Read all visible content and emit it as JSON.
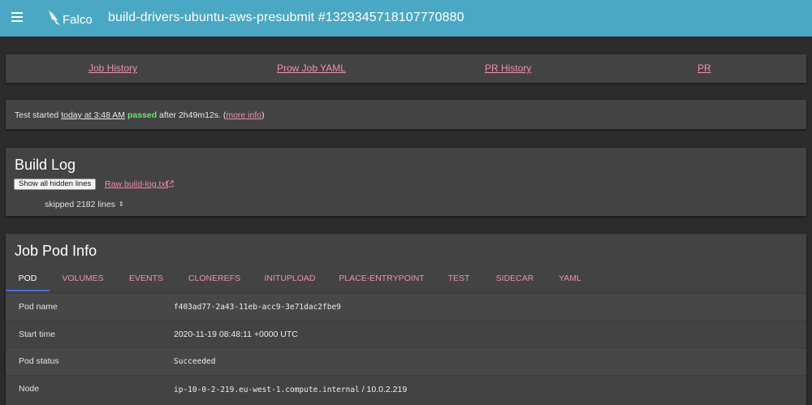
{
  "header": {
    "logo_text": "Falco",
    "title": "build-drivers-ubuntu-aws-presubmit #1329345718107770880"
  },
  "links": [
    {
      "label": "Job History"
    },
    {
      "label": "Prow Job YAML"
    },
    {
      "label": "PR History"
    },
    {
      "label": "PR"
    }
  ],
  "status": {
    "prefix": "Test started ",
    "time": "today at 3:48 AM",
    "result": "passed",
    "after": " after 2h49m12s. (",
    "more": "more info",
    "suffix": ")"
  },
  "build_log": {
    "title": "Build Log",
    "show_hidden": "Show all hidden lines",
    "raw_link": "Raw build-log.txt",
    "skipped": "skipped 2182 lines"
  },
  "pod_info": {
    "title": "Job Pod Info",
    "tabs": [
      "POD",
      "VOLUMES",
      "EVENTS",
      "CLONEREFS",
      "INITUPLOAD",
      "PLACE-ENTRYPOINT",
      "TEST",
      "SIDECAR",
      "YAML"
    ],
    "active_tab": "POD",
    "rows": [
      {
        "key": "Pod name",
        "value": "f403ad77-2a43-11eb-acc9-3e71dac2fbe9"
      },
      {
        "key": "Start time",
        "value": "2020-11-19 08:48:11 +0000 UTC"
      },
      {
        "key": "Pod status",
        "value": "Succeeded"
      },
      {
        "key": "Node",
        "value": "ip-10-0-2-219.eu-west-1.compute.internal",
        "value_extra": " / 10.0.2.219"
      }
    ]
  },
  "colors": {
    "header_bg": "#4aa8c4",
    "link": "#f08fb0",
    "passed": "#6ee36e",
    "tab_indicator": "#4a6fd8"
  }
}
